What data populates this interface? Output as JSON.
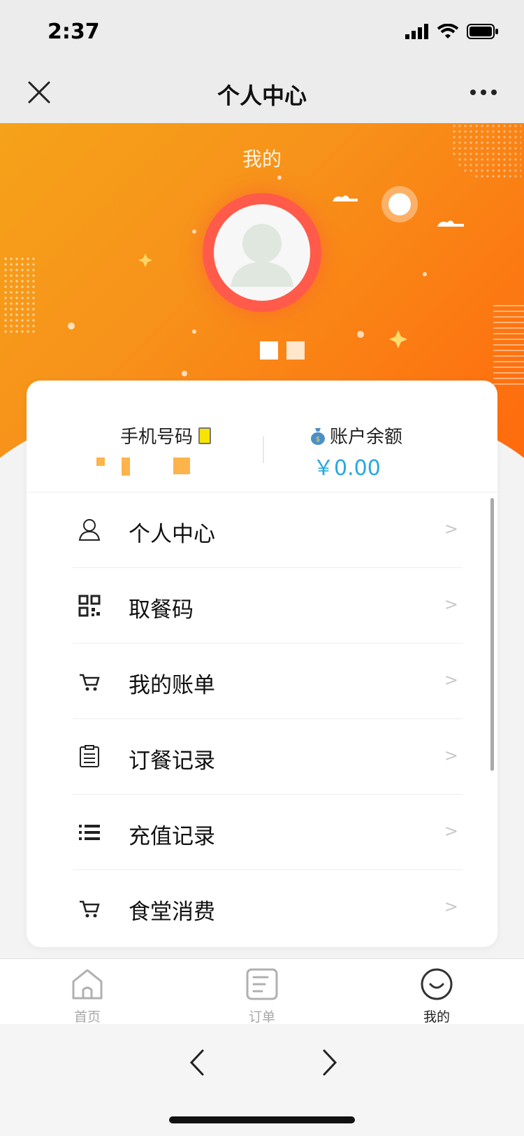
{
  "status": {
    "time": "2:37"
  },
  "nav": {
    "title": "个人中心"
  },
  "hero": {
    "title": "我的"
  },
  "info": {
    "phone_label": "手机号码",
    "balance_label": "账户余额",
    "balance_value": "￥0.00"
  },
  "menu": [
    {
      "label": "个人中心",
      "icon": "person-icon",
      "arrow": ">"
    },
    {
      "label": "取餐码",
      "icon": "qr-code-icon",
      "arrow": ">"
    },
    {
      "label": "我的账单",
      "icon": "cart-icon",
      "arrow": ">"
    },
    {
      "label": "订餐记录",
      "icon": "clipboard-icon",
      "arrow": ">"
    },
    {
      "label": "充值记录",
      "icon": "list-icon",
      "arrow": ">"
    },
    {
      "label": "食堂消费",
      "icon": "cart-icon",
      "arrow": ">"
    }
  ],
  "tabs": [
    {
      "label": "首页",
      "icon": "home-icon",
      "active": false
    },
    {
      "label": "订单",
      "icon": "order-icon",
      "active": false
    },
    {
      "label": "我的",
      "icon": "smile-icon",
      "active": true
    }
  ],
  "colors": {
    "accent": "#ff7a12",
    "balance": "#27a8e0",
    "avatar_ring": "#ff5a4a"
  }
}
